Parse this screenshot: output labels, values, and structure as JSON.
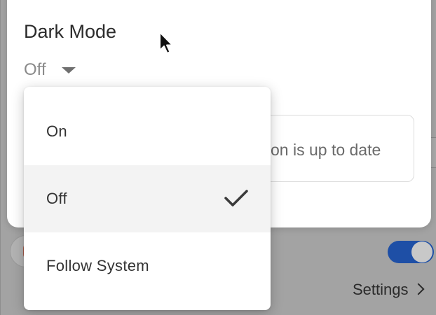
{
  "dark_mode": {
    "title": "Dark Mode",
    "selected_value": "Off"
  },
  "menu": {
    "options": [
      {
        "label": "On",
        "selected": false
      },
      {
        "label": "Off",
        "selected": true
      },
      {
        "label": "Follow System",
        "selected": false
      }
    ]
  },
  "info_box": {
    "text": "on is up to date"
  },
  "background": {
    "settings_link": "Settings",
    "toggle_on": true
  },
  "colors": {
    "toggle_accent": "#1e4fa6",
    "selected_row": "#f3f3f3",
    "overlay": "#a3a3a3"
  },
  "icons": [
    "caret-down-icon",
    "check-icon",
    "chevron-right-icon",
    "mouse-cursor-icon"
  ]
}
